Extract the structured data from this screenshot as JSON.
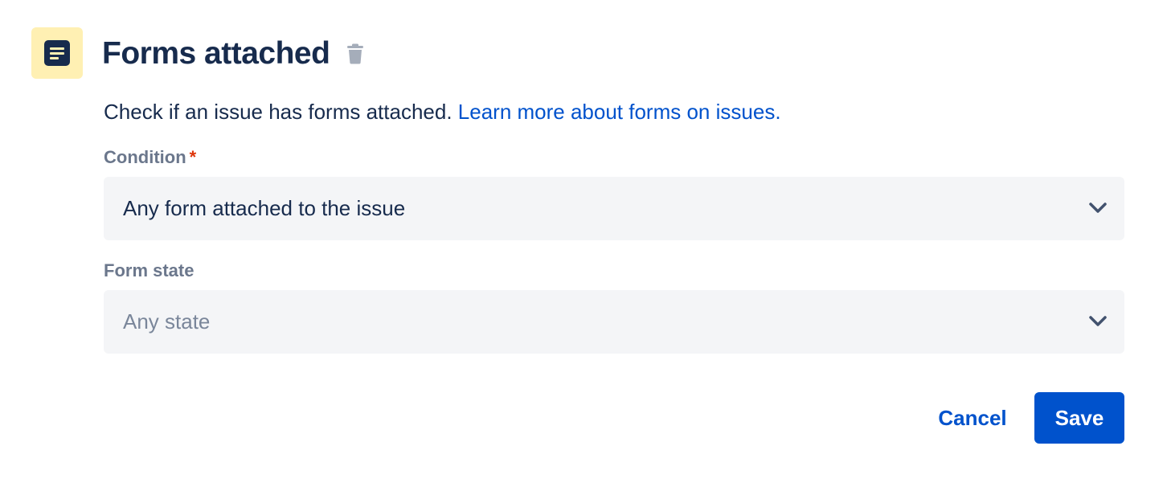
{
  "header": {
    "title": "Forms attached",
    "icon": "form-document-icon",
    "icon_bg": "#fff0b3",
    "delete_icon": "trash-icon"
  },
  "description": {
    "text": "Check if an issue has forms attached.",
    "link_text": "Learn more about forms on issues."
  },
  "condition": {
    "label": "Condition",
    "required_marker": "*",
    "value": "Any form attached to the issue",
    "icon": "chevron-down-icon"
  },
  "form_state": {
    "label": "Form state",
    "placeholder": "Any state",
    "icon": "chevron-down-icon"
  },
  "actions": {
    "cancel_label": "Cancel",
    "save_label": "Save"
  },
  "colors": {
    "primary": "#0052cc",
    "text": "#172b4d",
    "subtle_text": "#6b778c",
    "required": "#de350b",
    "field_bg": "#f4f5f7"
  }
}
